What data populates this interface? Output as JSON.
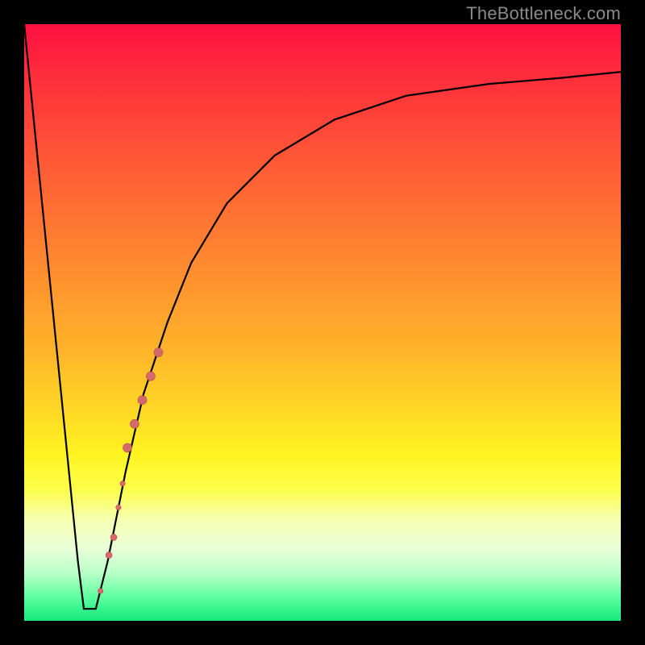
{
  "watermark": "TheBottleneck.com",
  "chart_data": {
    "type": "line",
    "title": "",
    "xlabel": "",
    "ylabel": "",
    "xlim": [
      0,
      100
    ],
    "ylim": [
      0,
      100
    ],
    "series": [
      {
        "name": "bottleneck-curve",
        "x": [
          0,
          3,
          6,
          9,
          10,
          11,
          12,
          14,
          17,
          20,
          24,
          28,
          34,
          42,
          52,
          64,
          78,
          90,
          100
        ],
        "y": [
          100,
          70,
          40,
          10,
          2,
          2,
          2,
          10,
          25,
          38,
          50,
          60,
          70,
          78,
          84,
          88,
          90,
          91,
          92
        ]
      }
    ],
    "markers": [
      {
        "name": "cluster-bar-top",
        "x": 22.5,
        "y": 45,
        "r": 5.5
      },
      {
        "name": "cluster-bar-uppermid",
        "x": 21.2,
        "y": 41,
        "r": 5.5
      },
      {
        "name": "cluster-bar-mid",
        "x": 19.8,
        "y": 37,
        "r": 5.5
      },
      {
        "name": "cluster-bar-lowermid",
        "x": 18.5,
        "y": 33,
        "r": 5.5
      },
      {
        "name": "cluster-bar-bottom",
        "x": 17.3,
        "y": 29,
        "r": 5.5
      },
      {
        "name": "dot-gap-upper",
        "x": 16.5,
        "y": 23,
        "r": 3.2
      },
      {
        "name": "dot-gap-lower",
        "x": 15.8,
        "y": 19,
        "r": 3.2
      },
      {
        "name": "cluster-small-top",
        "x": 15.0,
        "y": 14,
        "r": 4.0
      },
      {
        "name": "cluster-small-bottom",
        "x": 14.2,
        "y": 11,
        "r": 4.0
      },
      {
        "name": "dot-near-floor",
        "x": 12.8,
        "y": 5,
        "r": 3.2
      }
    ],
    "colors": {
      "curve": "#000000",
      "marker_fill": "#d46a6a",
      "marker_stroke": "#b84f4f"
    }
  }
}
